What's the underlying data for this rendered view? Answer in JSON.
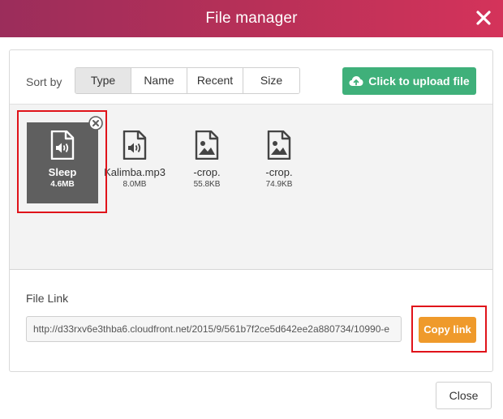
{
  "window": {
    "title": "File manager"
  },
  "sort": {
    "label": "Sort by",
    "options": [
      {
        "label": "Type",
        "active": true
      },
      {
        "label": "Name",
        "active": false
      },
      {
        "label": "Recent",
        "active": false
      },
      {
        "label": "Size",
        "active": false
      }
    ]
  },
  "upload": {
    "label": "Click to upload file",
    "icon": "cloud-upload-icon"
  },
  "files": [
    {
      "name": "Sleep",
      "size": "4.6MB",
      "kind": "audio-file-icon",
      "selected": true
    },
    {
      "name": "Kalimba.mp3",
      "size": "8.0MB",
      "kind": "audio-file-icon",
      "selected": false
    },
    {
      "name": "-crop.",
      "size": "55.8KB",
      "kind": "image-file-icon",
      "selected": false
    },
    {
      "name": "-crop.",
      "size": "74.9KB",
      "kind": "image-file-icon",
      "selected": false
    }
  ],
  "file_link": {
    "label": "File Link",
    "value": "http://d33rxv6e3thba6.cloudfront.net/2015/9/561b7f2ce5d642ee2a880734/10990-e",
    "copy_label": "Copy link"
  },
  "footer": {
    "close_label": "Close"
  },
  "colors": {
    "title_gradient_start": "#9b2d5b",
    "title_gradient_end": "#d4335a",
    "upload_green": "#3fb07a",
    "copy_orange": "#ef9a2b",
    "selected_tile": "#5f5f5f",
    "highlight_red": "#e0131a"
  }
}
